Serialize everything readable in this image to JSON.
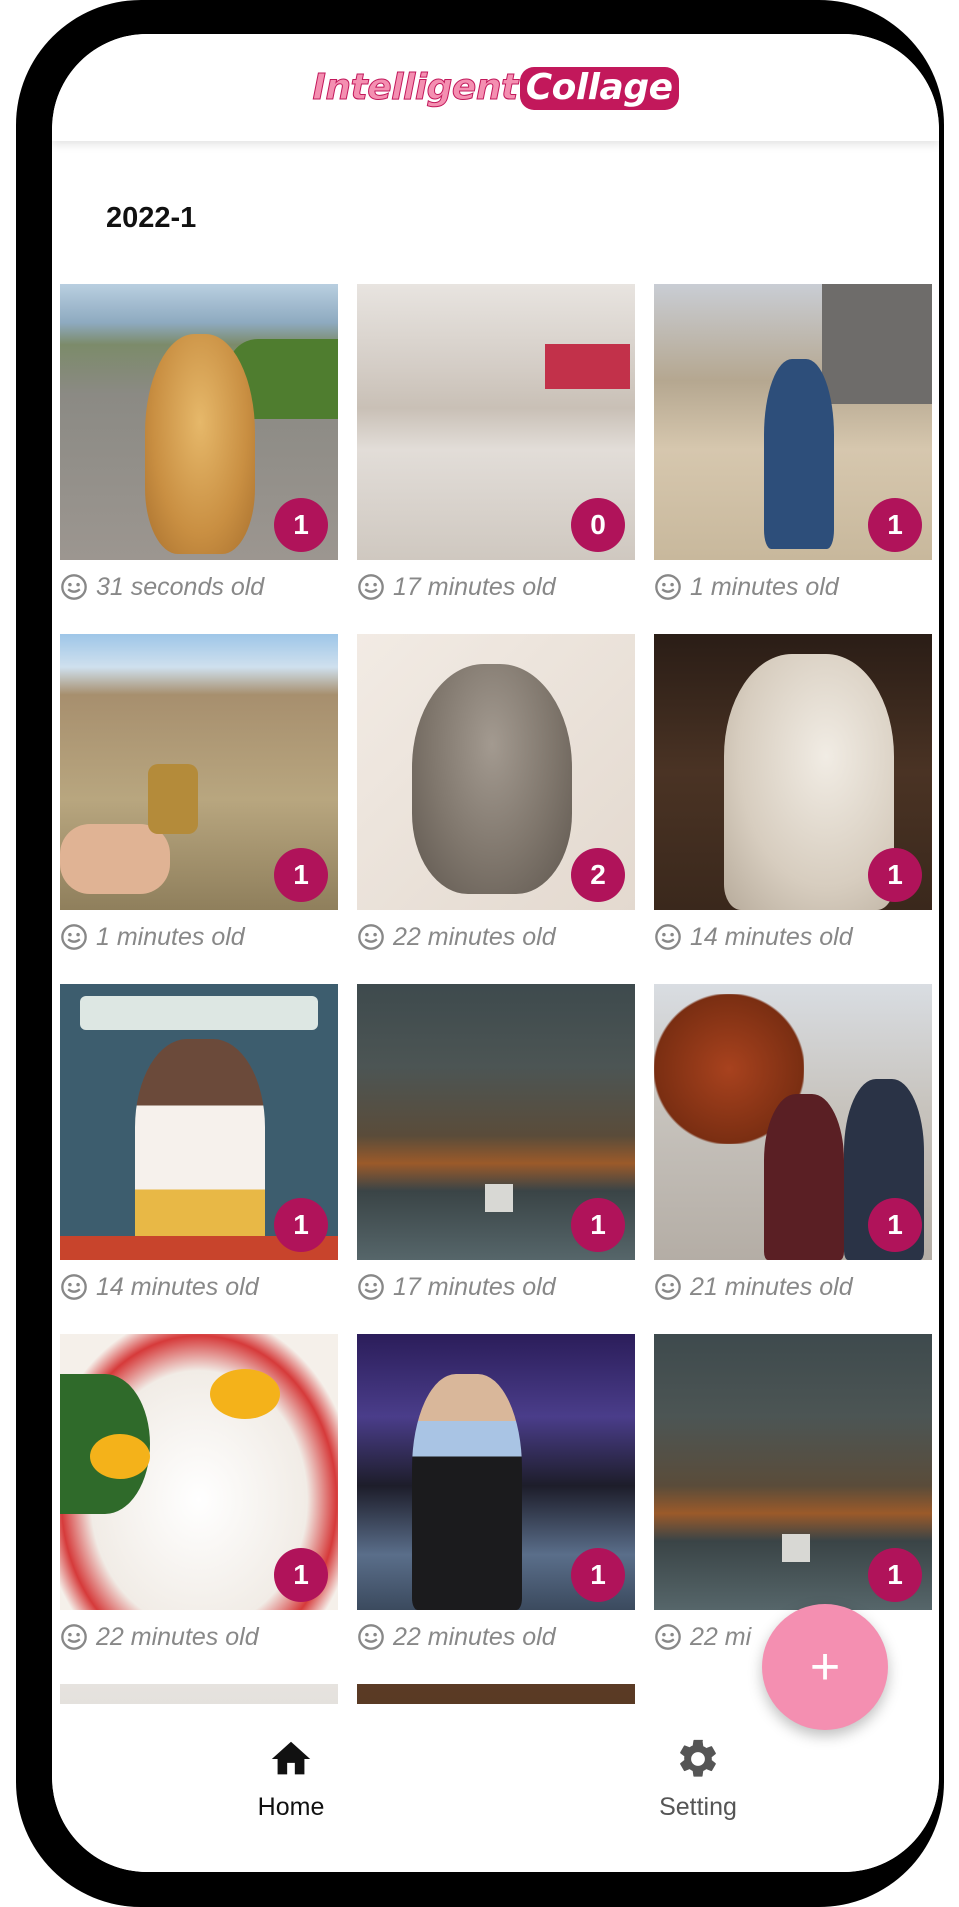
{
  "app": {
    "logo_part1": "Intelligent",
    "logo_part2": "Collage",
    "brand_color": "#b0135a",
    "accent_color": "#f48fb1"
  },
  "section": {
    "date": "2022-1"
  },
  "photos": [
    {
      "subject": "dog",
      "count": "1",
      "age": "31 seconds old"
    },
    {
      "subject": "mall",
      "count": "0",
      "age": "17 minutes old"
    },
    {
      "subject": "woman",
      "count": "1",
      "age": "1 minutes old"
    },
    {
      "subject": "cactus",
      "count": "1",
      "age": "1 minutes old"
    },
    {
      "subject": "cat",
      "count": "2",
      "age": "22 minutes old"
    },
    {
      "subject": "statue",
      "count": "1",
      "age": "14 minutes old"
    },
    {
      "subject": "poster",
      "count": "1",
      "age": "14 minutes old"
    },
    {
      "subject": "lake",
      "count": "1",
      "age": "17 minutes old"
    },
    {
      "subject": "couple",
      "count": "1",
      "age": "21 minutes old"
    },
    {
      "subject": "eggs",
      "count": "1",
      "age": "22 minutes old"
    },
    {
      "subject": "snooker",
      "count": "1",
      "age": "22 minutes old"
    },
    {
      "subject": "lake",
      "count": "1",
      "age": "22 mi"
    }
  ],
  "fab": {
    "icon": "plus-icon",
    "label": "+"
  },
  "bottom_nav": {
    "home_label": "Home",
    "home_icon": "home-icon",
    "setting_label": "Setting",
    "setting_icon": "gear-icon"
  }
}
